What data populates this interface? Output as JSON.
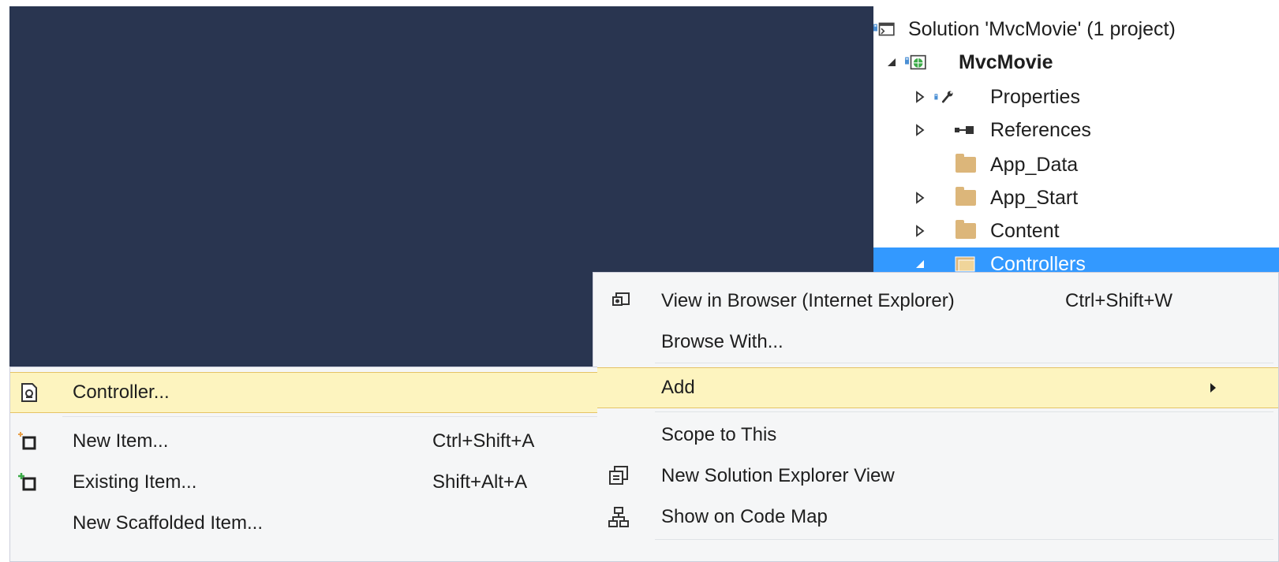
{
  "solution_explorer": {
    "items": [
      {
        "label": "Solution 'MvcMovie' (1 project)",
        "icon": "solution-icon"
      },
      {
        "label": "MvcMovie",
        "icon": "web-project-icon"
      },
      {
        "label": "Properties",
        "icon": "wrench-icon"
      },
      {
        "label": "References",
        "icon": "references-icon"
      },
      {
        "label": "App_Data",
        "icon": "folder-icon"
      },
      {
        "label": "App_Start",
        "icon": "folder-icon"
      },
      {
        "label": "Content",
        "icon": "folder-icon"
      },
      {
        "label": "Controllers",
        "icon": "folder-open-icon"
      }
    ],
    "selected_item": "Controllers"
  },
  "context_menu": {
    "items": [
      {
        "label": "View in Browser (Internet Explorer)",
        "shortcut": "Ctrl+Shift+W",
        "icon": "browser-icon"
      },
      {
        "label": "Browse With...",
        "shortcut": ""
      },
      {
        "label": "Add",
        "shortcut": "",
        "has_submenu": true
      },
      {
        "label": "Scope to This",
        "shortcut": ""
      },
      {
        "label": "New Solution Explorer View",
        "shortcut": "",
        "icon": "new-view-icon"
      },
      {
        "label": "Show on Code Map",
        "shortcut": "",
        "icon": "code-map-icon"
      }
    ],
    "highlighted_item": "Add"
  },
  "add_submenu": {
    "items": [
      {
        "label": "Controller...",
        "shortcut": "",
        "icon": "controller-icon"
      },
      {
        "label": "New Item...",
        "shortcut": "Ctrl+Shift+A",
        "icon": "new-item-icon"
      },
      {
        "label": "Existing Item...",
        "shortcut": "Shift+Alt+A",
        "icon": "existing-item-icon"
      },
      {
        "label": "New Scaffolded Item...",
        "shortcut": ""
      }
    ],
    "highlighted_item": "Controller..."
  },
  "colors": {
    "editor_background": "#293550",
    "selection_blue": "#3399ff",
    "menu_background": "#f5f6f7",
    "menu_highlight": "#fdf4bf",
    "folder": "#dcb67a"
  }
}
